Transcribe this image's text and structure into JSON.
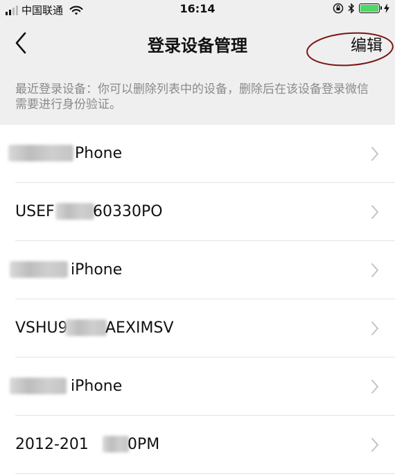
{
  "status_bar": {
    "carrier": "中国联通",
    "time": "16:14"
  },
  "nav": {
    "title": "登录设备管理",
    "edit_label": "编辑"
  },
  "description": "最近登录设备：你可以删除列表中的设备，删除后在该设备登录微信需要进行身份验证。",
  "devices": [
    {
      "label": "Phone"
    },
    {
      "label_start": "USEF",
      "label_end": "60330PO"
    },
    {
      "label": "iPhone"
    },
    {
      "label_start": "VSHU9",
      "label_end": "AEXIMSV"
    },
    {
      "label": "iPhone"
    },
    {
      "label_start": "2012-201",
      "label_end": "0PM"
    }
  ],
  "colors": {
    "accent_battery": "#4cd964",
    "annotation": "#7a1414",
    "description_text": "#8a8a8a"
  }
}
